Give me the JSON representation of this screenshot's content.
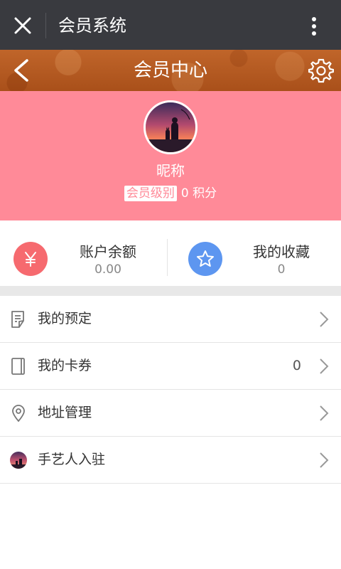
{
  "wechat_bar": {
    "title": "会员系统"
  },
  "header": {
    "title": "会员中心"
  },
  "profile": {
    "nickname": "昵称",
    "level": "会员级别",
    "points": "0 积分"
  },
  "stats": {
    "balance": {
      "label": "账户余额",
      "value": "0.00",
      "icon": "yen-icon",
      "color": "#f66a6f"
    },
    "favorites": {
      "label": "我的收藏",
      "value": "0",
      "icon": "star-icon",
      "color": "#5d96f0"
    }
  },
  "menu": {
    "items": [
      {
        "label": "我的预定",
        "icon": "document-icon"
      },
      {
        "label": "我的卡券",
        "icon": "card-icon",
        "count": "0"
      },
      {
        "label": "地址管理",
        "icon": "location-pin-icon"
      },
      {
        "label": "手艺人入驻",
        "icon": "avatar-thumbnail-icon"
      }
    ]
  },
  "colors": {
    "wechat_bar": "#393a3f",
    "header": "#b8591c",
    "profile_bg": "#ff8a98"
  }
}
